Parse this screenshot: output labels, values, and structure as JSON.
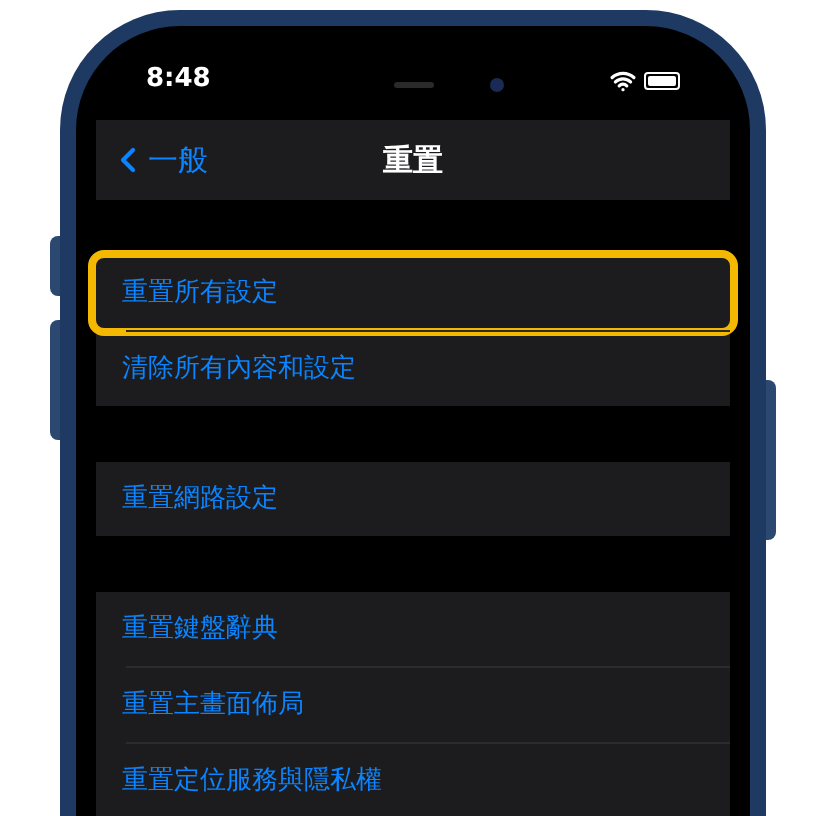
{
  "status_bar": {
    "time": "8:48"
  },
  "nav": {
    "back": "一般",
    "title": "重置"
  },
  "groups": [
    {
      "items": [
        {
          "label": "重置所有設定",
          "highlighted": true
        },
        {
          "label": "清除所有內容和設定",
          "highlighted": false
        }
      ]
    },
    {
      "items": [
        {
          "label": "重置網路設定",
          "highlighted": false
        }
      ]
    },
    {
      "items": [
        {
          "label": "重置鍵盤辭典",
          "highlighted": false
        },
        {
          "label": "重置主畫面佈局",
          "highlighted": false
        },
        {
          "label": "重置定位服務與隱私權",
          "highlighted": false
        }
      ]
    }
  ]
}
